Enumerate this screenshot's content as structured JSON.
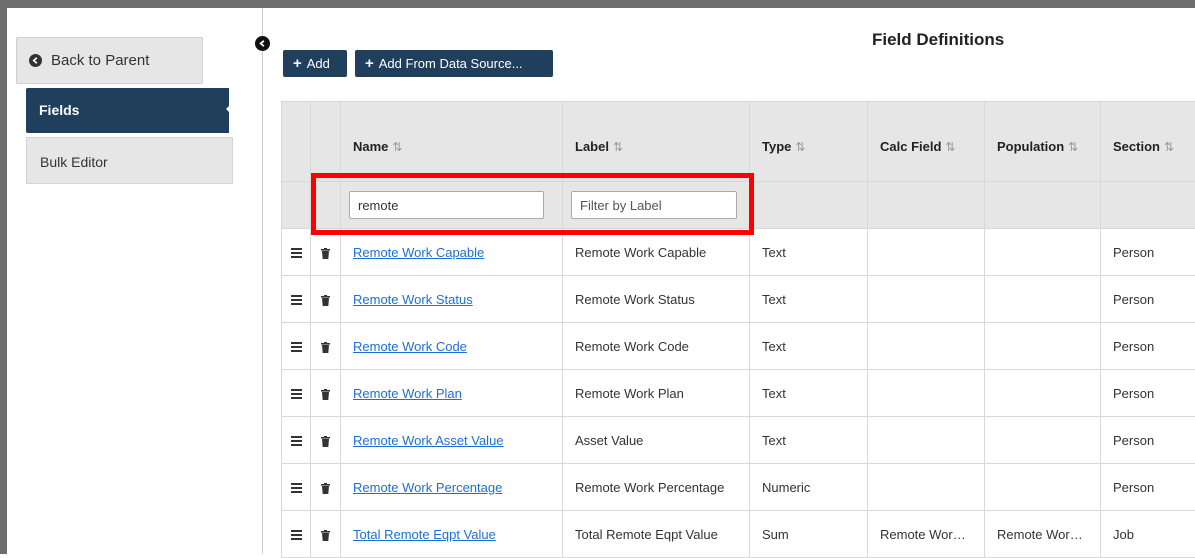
{
  "sidebar": {
    "back_label": "Back to Parent",
    "items": [
      {
        "label": "Fields",
        "active": true
      },
      {
        "label": "Bulk Editor",
        "active": false
      }
    ]
  },
  "header": {
    "title": "Field Definitions",
    "add_label": "Add",
    "add_from_source_label": "Add From Data Source..."
  },
  "table": {
    "columns": [
      "Name",
      "Label",
      "Type",
      "Calc Field",
      "Population",
      "Section"
    ],
    "sort_icon": "sort-icon",
    "filters": {
      "name_value": "remote",
      "label_placeholder": "Filter by Label"
    },
    "rows": [
      {
        "name": "Remote Work Capable",
        "label": "Remote Work Capable",
        "type": "Text",
        "calc": "",
        "population": "",
        "section": "Person"
      },
      {
        "name": "Remote Work Status",
        "label": "Remote Work Status",
        "type": "Text",
        "calc": "",
        "population": "",
        "section": "Person"
      },
      {
        "name": "Remote Work Code",
        "label": "Remote Work Code",
        "type": "Text",
        "calc": "",
        "population": "",
        "section": "Person"
      },
      {
        "name": "Remote Work Plan",
        "label": "Remote Work Plan",
        "type": "Text",
        "calc": "",
        "population": "",
        "section": "Person"
      },
      {
        "name": "Remote Work Asset Value",
        "label": "Asset Value",
        "type": "Text",
        "calc": "",
        "population": "",
        "section": "Person"
      },
      {
        "name": "Remote Work Percentage",
        "label": "Remote Work Percentage",
        "type": "Numeric",
        "calc": "",
        "population": "",
        "section": "Person"
      },
      {
        "name": "Total Remote Eqpt Value",
        "label": "Total Remote Eqpt Value",
        "type": "Sum",
        "calc": "Remote Wor…",
        "population": "Remote Wor…",
        "section": "Job"
      }
    ]
  },
  "colors": {
    "primary": "#203f5c",
    "link": "#1c6fd6",
    "highlight": "#ff0000",
    "header_bg": "#e6e6e6"
  }
}
